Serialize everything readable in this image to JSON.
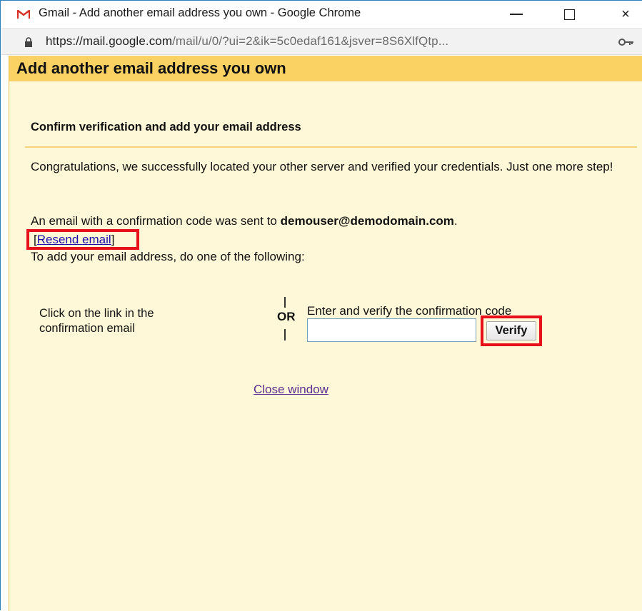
{
  "window": {
    "title": "Gmail - Add another email address you own - Google Chrome",
    "controls": {
      "minimize": "minimize",
      "maximize": "maximize",
      "close": "×"
    }
  },
  "addressbar": {
    "url_host": "https://mail.google.com",
    "url_path": "/mail/u/0/?ui=2&ik=5c0edaf161&jsver=8S6XlfQtp..."
  },
  "page": {
    "header_title": "Add another email address you own",
    "section_title": "Confirm verification and add your email address",
    "congrats_text": "Congratulations, we successfully located your other server and verified your credentials. Just one more step!",
    "sent_text_prefix": "An email with a confirmation code was sent to ",
    "sent_email": "demouser@demodomain.com",
    "sent_text_suffix": ".",
    "resend_bracket_open": "[",
    "resend_link": "Resend email",
    "resend_bracket_close": "]",
    "instruction": "To add your email address, do one of the following:",
    "option_link_text": "Click on the link in the confirmation email",
    "or_label": "OR",
    "verify_label": "Enter and verify the confirmation code",
    "code_input_value": "",
    "verify_button": "Verify",
    "close_link": "Close window"
  },
  "colors": {
    "header_bg": "#fad163",
    "content_bg": "#fff8d8",
    "highlight": "#e8111b",
    "link": "#1a0dab",
    "visited_link": "#5a2d91"
  },
  "icons": [
    "gmail-icon",
    "lock-icon",
    "key-icon"
  ]
}
